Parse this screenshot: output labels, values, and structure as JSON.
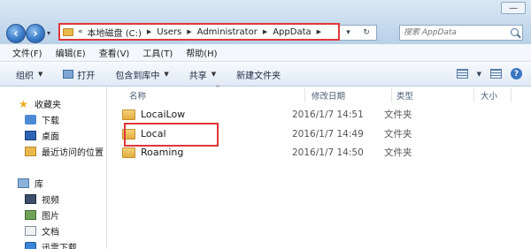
{
  "window": {
    "controls_label": "—"
  },
  "address": {
    "lead": "«",
    "crumbs": [
      "本地磁盘 (C:)",
      "Users",
      "Administrator",
      "AppData"
    ],
    "refresh_label": "↻",
    "dropdown_label": "▾"
  },
  "search": {
    "placeholder": "搜索 AppData"
  },
  "menu": {
    "items": [
      "文件(F)",
      "编辑(E)",
      "查看(V)",
      "工具(T)",
      "帮助(H)"
    ]
  },
  "toolbar": {
    "organize": "组织",
    "open": "打开",
    "include_in_library": "包含到库中",
    "share": "共享",
    "new_folder": "新建文件夹",
    "help": "?"
  },
  "nav": {
    "favorites": "收藏夹",
    "downloads": "下载",
    "desktop": "桌面",
    "recent": "最近访问的位置",
    "libraries": "库",
    "videos": "视频",
    "pictures": "图片",
    "documents": "文档",
    "thunder": "迅雷下载"
  },
  "columns": {
    "name": "名称",
    "modified": "修改日期",
    "type": "类型",
    "size": "大小"
  },
  "files": [
    {
      "name": "LocaiLow",
      "modified": "2016/1/7 14:51",
      "type": "文件夹"
    },
    {
      "name": "Local",
      "modified": "2016/1/7 14:49",
      "type": "文件夹"
    },
    {
      "name": "Roaming",
      "modified": "2016/1/7 14:50",
      "type": "文件夹"
    }
  ],
  "colors": {
    "highlight": "#e0363a",
    "folder": "#e3ad3d"
  }
}
